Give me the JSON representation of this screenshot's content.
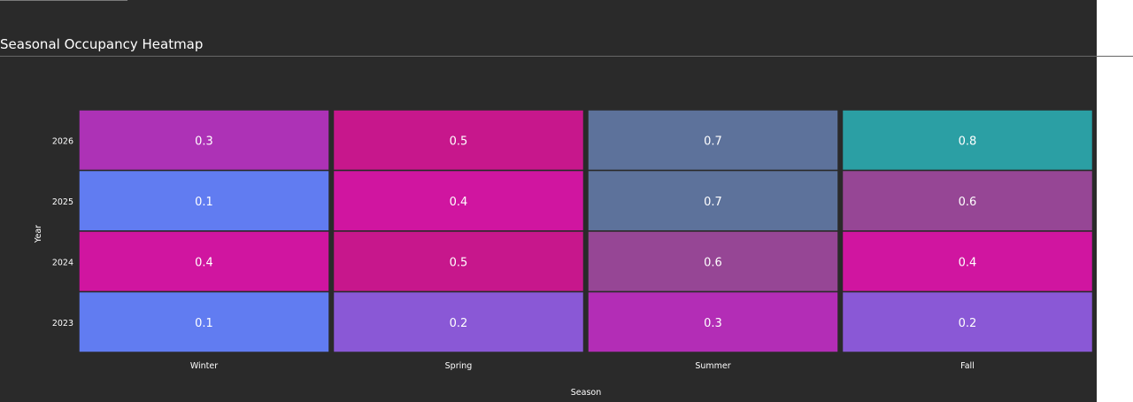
{
  "title": "Seasonal Occupancy Heatmap",
  "chart_data": {
    "type": "heatmap",
    "title": "Seasonal Occupancy Heatmap",
    "xlabel": "Season",
    "ylabel": "Year",
    "x_categories": [
      "Winter",
      "Spring",
      "Summer",
      "Fall"
    ],
    "y_categories": [
      "2026",
      "2025",
      "2024",
      "2023"
    ],
    "values": [
      [
        0.3,
        0.5,
        0.7,
        0.8
      ],
      [
        0.1,
        0.4,
        0.7,
        0.6
      ],
      [
        0.4,
        0.5,
        0.6,
        0.4
      ],
      [
        0.1,
        0.2,
        0.3,
        0.2
      ]
    ],
    "cell_colors": [
      [
        "#ad32b6",
        "#c7178c",
        "#5d729b",
        "#2b9fa4"
      ],
      [
        "#617cf1",
        "#d015a0",
        "#5d729b",
        "#964695"
      ],
      [
        "#d015a0",
        "#c7178c",
        "#964695",
        "#d015a0"
      ],
      [
        "#617cf1",
        "#8a58d6",
        "#b32db6",
        "#8a58d6"
      ]
    ],
    "background": "#2a2a2a"
  }
}
